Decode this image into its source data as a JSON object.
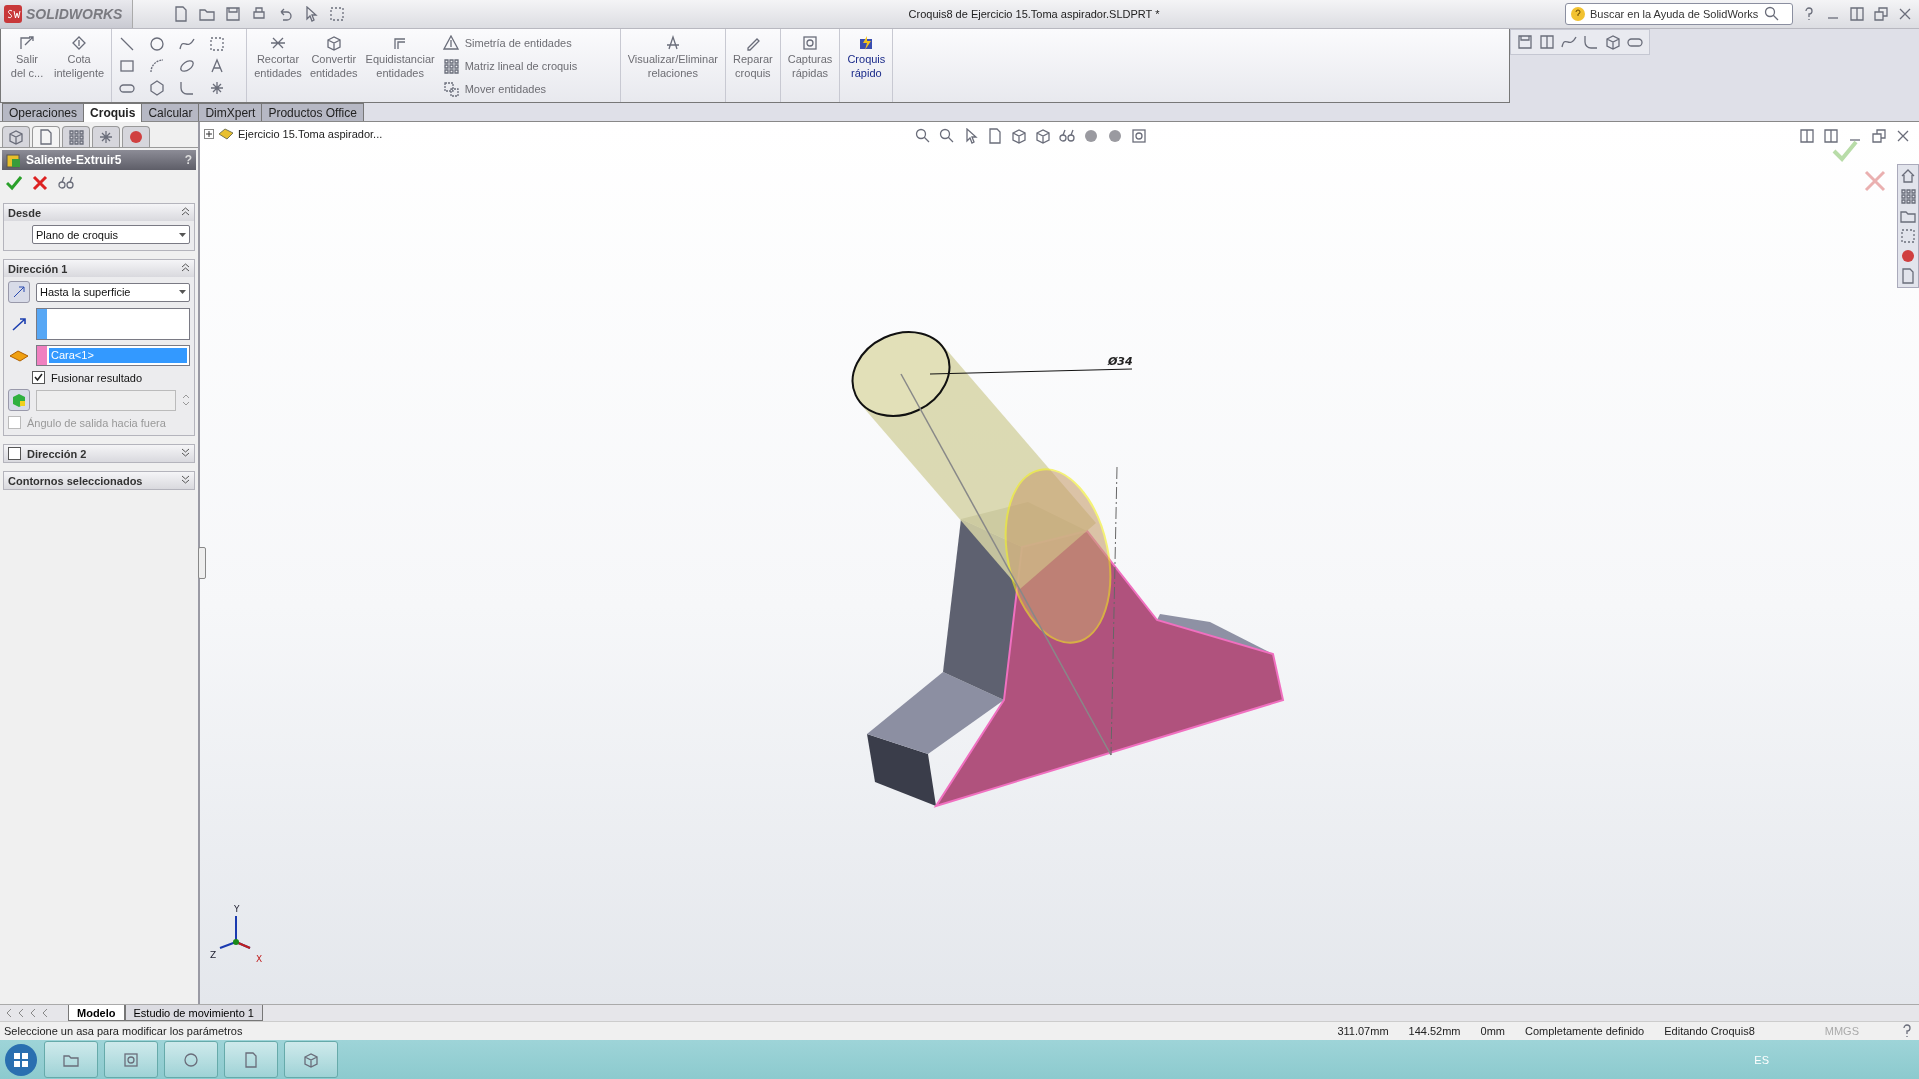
{
  "app": {
    "logo": "SOLIDWORKS"
  },
  "window": {
    "title": "Croquis8 de Ejercicio 15.Toma aspirador.SLDPRT *"
  },
  "help_search": {
    "placeholder": "Buscar en la Ayuda de SolidWorks"
  },
  "ribbon": {
    "left_buttons": [
      {
        "lines": [
          "Salir",
          "del c..."
        ],
        "selected": false
      },
      {
        "lines": [
          "Cota",
          "inteligente"
        ],
        "selected": false
      }
    ],
    "mid_buttons": [
      {
        "lines": [
          "Recortar",
          "entidades"
        ],
        "selected": false
      },
      {
        "lines": [
          "Convertir",
          "entidades"
        ],
        "selected": false
      },
      {
        "lines": [
          "Equidistanciar",
          "entidades"
        ],
        "selected": false
      }
    ],
    "small_commands": [
      "Simetría de entidades",
      "Matriz lineal de croquis",
      "Mover entidades"
    ],
    "right_buttons": [
      {
        "lines": [
          "Visualizar/Eliminar",
          "relaciones"
        ],
        "selected": false
      },
      {
        "lines": [
          "Reparar",
          "croquis"
        ],
        "selected": false
      },
      {
        "lines": [
          "Capturas",
          "rápidas"
        ],
        "selected": false
      },
      {
        "lines": [
          "Croquis",
          "rápido"
        ],
        "selected": true
      }
    ]
  },
  "command_tabs": [
    {
      "label": "Operaciones",
      "selected": false
    },
    {
      "label": "Croquis",
      "selected": true
    },
    {
      "label": "Calcular",
      "selected": false
    },
    {
      "label": "DimXpert",
      "selected": false
    },
    {
      "label": "Productos Office",
      "selected": false
    }
  ],
  "panel_tabs": [
    {
      "selected": false
    },
    {
      "selected": true
    },
    {
      "selected": false
    },
    {
      "selected": false
    },
    {
      "selected": false
    }
  ],
  "property_manager": {
    "title": "Saliente-Extruir5",
    "help": "?",
    "desde": {
      "title": "Desde",
      "expanded": true,
      "condition": "Plano de croquis"
    },
    "direccion1": {
      "title": "Dirección 1",
      "expanded": true,
      "end_condition": "Hasta la superficie",
      "face": "Cara<1>",
      "merge": {
        "label": "Fusionar resultado",
        "checked": true
      },
      "draft_outward": {
        "label": "Ángulo de salida hacia fuera",
        "checked": false,
        "disabled": true
      }
    },
    "direccion2": {
      "title": "Dirección 2",
      "checked": false,
      "expanded": false
    },
    "contornos": {
      "title": "Contornos seleccionados",
      "expanded": false
    }
  },
  "feature_tree": {
    "root": "Ejercicio 15.Toma aspirador...",
    "expanded": false
  },
  "viewport": {
    "dimension": "Ø34",
    "axes": [
      "Y",
      "Z",
      "X"
    ]
  },
  "bottom_tabs": [
    {
      "label": "Modelo",
      "selected": true
    },
    {
      "label": "Estudio de movimiento 1",
      "selected": false
    }
  ],
  "status_bar": {
    "message": "Seleccione un asa para modificar los parámetros",
    "fields": [
      "311.07mm",
      "144.52mm",
      "0mm",
      "Completamente definido",
      "Editando Croquis8"
    ],
    "units": "MMGS"
  },
  "taskbar": {
    "language": "ES"
  }
}
